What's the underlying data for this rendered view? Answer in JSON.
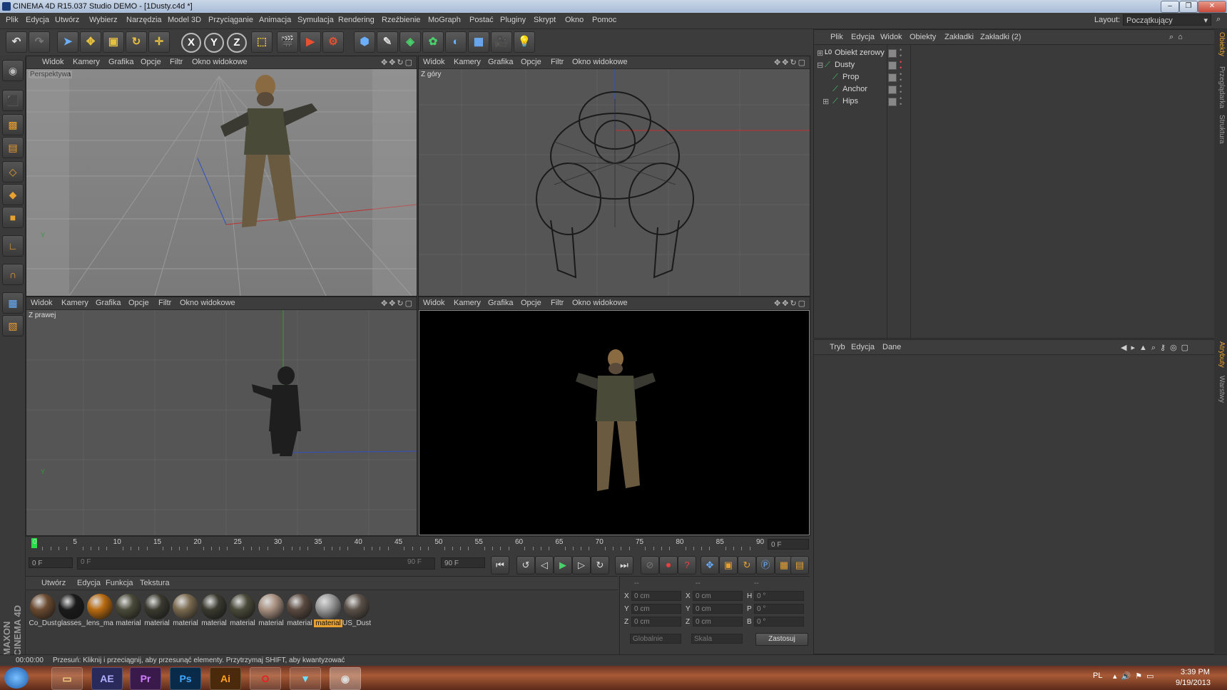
{
  "window": {
    "title": "CINEMA 4D R15.037 Studio DEMO - [1Dusty.c4d *]",
    "minimize": "–",
    "maximize": "❐",
    "close": "✕"
  },
  "menu": [
    "Plik",
    "Edycja",
    "Utwórz",
    "Wybierz",
    "Narzędzia",
    "Model 3D",
    "Przyciąganie",
    "Animacja",
    "Symulacja",
    "Rendering",
    "Rzeźbienie",
    "MoGraph",
    "Postać",
    "Pluginy",
    "Skrypt",
    "Okno",
    "Pomoc"
  ],
  "layout": {
    "label": "Layout:",
    "value": "Początkujący"
  },
  "toolbar_icons": [
    "undo-icon",
    "redo-icon",
    "select-arrow-icon",
    "move-icon",
    "scale-icon",
    "rotate-icon",
    "live-move-icon",
    "x-axis-icon",
    "y-axis-icon",
    "z-axis-icon",
    "coordinate-system-icon",
    "render-view-icon",
    "render-picture-viewer-icon",
    "render-settings-icon",
    "cube-icon",
    "spline-pen-icon",
    "subdivision-icon",
    "cloner-icon",
    "deformer-icon",
    "floor-icon",
    "camera-icon",
    "light-icon"
  ],
  "toolbar_axis": {
    "x": "X",
    "y": "Y",
    "z": "Z"
  },
  "viewport_menu": [
    "Widok",
    "Kamery",
    "Grafika",
    "Opcje",
    "Filtr",
    "Okno widokowe"
  ],
  "viewports": [
    {
      "name": "Perspektywa"
    },
    {
      "name": "Z góry"
    },
    {
      "name": "Z prawej"
    },
    {
      "name": ""
    }
  ],
  "object_manager": {
    "menu": [
      "Plik",
      "Edycja",
      "Widok",
      "Obiekty",
      "Zakładki",
      "Zakładki (2)"
    ],
    "objects": [
      {
        "name": "Obiekt zerowy",
        "indent": 0,
        "expander": "⊞"
      },
      {
        "name": "Dusty",
        "indent": 0,
        "expander": "⊟"
      },
      {
        "name": "Prop",
        "indent": 1,
        "expander": ""
      },
      {
        "name": "Anchor",
        "indent": 1,
        "expander": ""
      },
      {
        "name": "Hips",
        "indent": 1,
        "expander": "⊞"
      }
    ]
  },
  "attribute_manager": {
    "menu": [
      "Tryb",
      "Edycja",
      "Dane"
    ]
  },
  "right_tabs": [
    "Obiekty",
    "Przeglądarka",
    "Struktura",
    "Atrybuty",
    "Warstwy"
  ],
  "timeline": {
    "ticks": [
      "0",
      "5",
      "10",
      "15",
      "20",
      "25",
      "30",
      "35",
      "40",
      "45",
      "50",
      "55",
      "60",
      "65",
      "70",
      "75",
      "80",
      "85",
      "90"
    ],
    "current_frame": "0 F",
    "start_field": "0 F",
    "range_start": "0 F",
    "range_end": "90 F",
    "end_field": "90 F"
  },
  "material_manager": {
    "menu": [
      "Utwórz",
      "Edycja",
      "Funkcja",
      "Tekstura"
    ],
    "materials": [
      {
        "name": "Co_Dust",
        "color": "#6a4a30",
        "selected": false
      },
      {
        "name": "glasses_",
        "color": "#1a1a1a",
        "selected": false
      },
      {
        "name": "lens_ma",
        "color": "#b86a10",
        "selected": false
      },
      {
        "name": "material",
        "color": "#4a4a3a",
        "selected": false
      },
      {
        "name": "material",
        "color": "#3a3a30",
        "selected": false
      },
      {
        "name": "material",
        "color": "#7a6a50",
        "selected": false
      },
      {
        "name": "material",
        "color": "#3a3a30",
        "selected": false
      },
      {
        "name": "material",
        "color": "#4a4a3a",
        "selected": false
      },
      {
        "name": "material",
        "color": "#a89080",
        "selected": false
      },
      {
        "name": "material",
        "color": "#5a4a40",
        "selected": false
      },
      {
        "name": "material",
        "color": "#9a9a9a",
        "selected": true
      },
      {
        "name": "US_Dust",
        "color": "#5a5048",
        "selected": false
      }
    ]
  },
  "coordinates": {
    "header": [
      "--",
      "--",
      "--"
    ],
    "rows": [
      {
        "a": "X",
        "av": "0 cm",
        "b": "X",
        "bv": "0 cm",
        "c": "H",
        "cv": "0 °"
      },
      {
        "a": "Y",
        "av": "0 cm",
        "b": "Y",
        "bv": "0 cm",
        "c": "P",
        "cv": "0 °"
      },
      {
        "a": "Z",
        "av": "0 cm",
        "b": "Z",
        "bv": "0 cm",
        "c": "B",
        "cv": "0 °"
      }
    ],
    "mode1": "Globalnie",
    "mode2": "Skala",
    "apply": "Zastosuj"
  },
  "status": {
    "time": "00:00:00",
    "message": "Przesuń: Kliknij i przeciągnij, aby przesunąć elementy. Przytrzymaj SHIFT, aby kwantyzować"
  },
  "branding": "MAXON CINEMA 4D",
  "taskbar": {
    "apps": [
      "AE",
      "Pr",
      "Ps",
      "Ai"
    ],
    "lang": "PL",
    "time": "3:39 PM",
    "date": "9/19/2013"
  }
}
